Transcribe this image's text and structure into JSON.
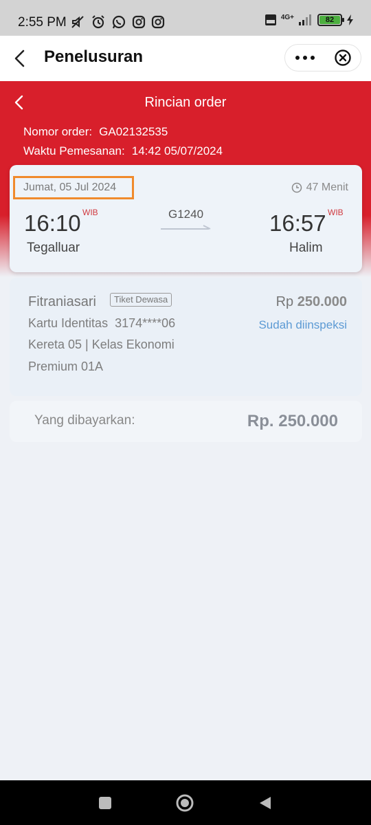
{
  "status_bar": {
    "time": "2:55 PM",
    "network": "4G+",
    "battery": "82",
    "icons": [
      "mute-icon",
      "alarm-icon",
      "whatsapp-icon",
      "instagram-icon",
      "instagram-icon"
    ]
  },
  "title_bar": {
    "title": "Penelusuran"
  },
  "header": {
    "title": "Rincian order",
    "order_number_label": "Nomor order:",
    "order_number": "GA02132535",
    "order_time_label": "Waktu Pemesanan:",
    "order_time": "14:42 05/07/2024"
  },
  "trip": {
    "date": "Jumat, 05 Jul 2024",
    "duration": "47 Menit",
    "departure_time": "16:10",
    "departure_tz": "WIB",
    "departure_station": "Tegalluar",
    "train_number": "G1240",
    "arrival_time": "16:57",
    "arrival_tz": "WIB",
    "arrival_station": "Halim"
  },
  "passenger": {
    "name": "Fitraniasari",
    "ticket_type": "Tiket Dewasa",
    "price_currency": "Rp",
    "price_value": "250.000",
    "id_label": "Kartu Identitas",
    "id_number": "3174****06",
    "status": "Sudah diinspeksi",
    "coach": "Kereta 05 | Kelas Ekonomi",
    "seat": "Premium 01A"
  },
  "total": {
    "label": "Yang dibayarkan:",
    "value": "Rp. 250.000"
  },
  "colors": {
    "brand_red": "#d81f2b",
    "highlight_orange": "#f08a2c",
    "link_blue": "#5c9ad4"
  }
}
